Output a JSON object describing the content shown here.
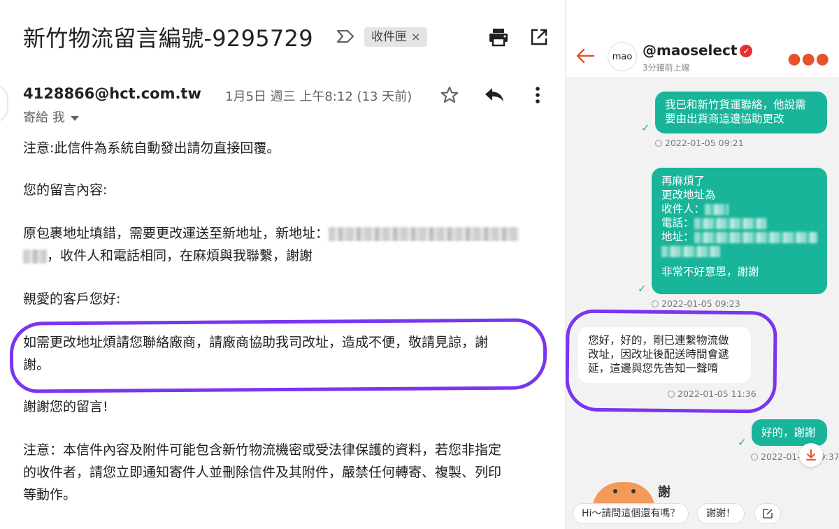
{
  "email": {
    "subject": "新竹物流留言編號-9295729",
    "label_chip": "收件匣",
    "label_chip_close": "×",
    "sender": "4128866@hct.com.tw",
    "to_me": "寄給 我",
    "date": "1月5日 週三 上午8:12 (13 天前)",
    "lines": [
      "注意:此信件為系統自動發出請勿直接回覆。",
      "您的留言內容:",
      "原包裹地址填錯，需要更改運送至新地址，新地址：",
      "，收件人和電話相同，在麻煩與我聯繫，謝謝",
      "親愛的客戶您好:",
      "如需更改地址煩請您聯絡廠商，請廠商協助我司改址，造成不便，敬請見諒，謝",
      "謝。",
      "謝謝您的留言!",
      "注意：本信件內容及附件可能包含新竹物流機密或受法律保護的資料，若您非指定",
      "的收件者，請您立即通知寄件人並刪除信件及其附件，嚴禁任何轉寄、複製、列印",
      "等動作。"
    ],
    "icons": [
      "label-arrow-icon",
      "print-icon",
      "open-in-new-icon",
      "star-icon",
      "reply-icon",
      "more-vert-icon"
    ]
  },
  "chat": {
    "handle": "@maoselect",
    "avatar_text": "mao",
    "verified_mark": "✓",
    "status": "3分鐘前上線",
    "messages": [
      {
        "dir": "out",
        "lines": [
          "我已和新竹貨運聯絡，他說需",
          "要由出貨商這邊協助更改"
        ],
        "time": "2022-01-05 09:21"
      },
      {
        "dir": "out",
        "lines": [
          "再麻煩了",
          "更改地址為",
          "收件人：",
          "電話：",
          "地址：",
          "",
          "非常不好意思，謝謝"
        ],
        "time": "2022-01-05 09:23"
      },
      {
        "dir": "in",
        "lines": [
          "您好，好的，剛已連繫物流做",
          "改址，因改址後配送時間會遞",
          "延，這邊與您先告知一聲唷"
        ],
        "time": "2022-01-05 11:36"
      },
      {
        "dir": "out",
        "lines": [
          "好的，謝謝"
        ],
        "time": "2022-01-05 09:37"
      }
    ],
    "partial_text": "謝",
    "quick_replies": [
      "Hi～請問這個還有嗎？",
      "謝謝！"
    ],
    "accent_color": "#18b59a",
    "brand_color": "#e5532d",
    "highlight_color": "#7a35f0"
  }
}
